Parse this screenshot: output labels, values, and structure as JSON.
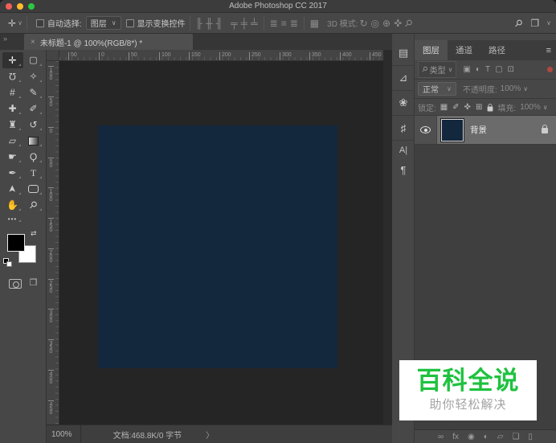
{
  "window": {
    "title": "Adobe Photoshop CC 2017"
  },
  "options_bar": {
    "auto_select_label": "自动选择:",
    "auto_select_value": "图层",
    "show_transform_label": "显示变换控件",
    "mode_3d_label": "3D 模式:"
  },
  "document_tab": {
    "close": "×",
    "title": "未标题-1 @ 100%(RGB/8*) *"
  },
  "toolbar": {
    "collapse_chevron": "»",
    "more_dots": "•••",
    "tools": [
      {
        "name": "move",
        "glyph": "✛"
      },
      {
        "name": "rectangular-marquee",
        "glyph": "▢"
      },
      {
        "name": "lasso",
        "glyph": "Ω"
      },
      {
        "name": "quick-selection",
        "glyph": "✧"
      },
      {
        "name": "crop",
        "glyph": "#"
      },
      {
        "name": "eyedropper",
        "glyph": "✎"
      },
      {
        "name": "spot-healing",
        "glyph": "✚"
      },
      {
        "name": "brush",
        "glyph": "✐"
      },
      {
        "name": "clone-stamp",
        "glyph": "♜"
      },
      {
        "name": "history-brush",
        "glyph": "↺"
      },
      {
        "name": "eraser",
        "glyph": "▱"
      },
      {
        "name": "smudge",
        "glyph": "☛"
      },
      {
        "name": "dodge",
        "glyph": "Ϙ"
      },
      {
        "name": "pen",
        "glyph": "✒"
      },
      {
        "name": "type",
        "glyph": "T"
      },
      {
        "name": "path-selection",
        "glyph": "➤"
      },
      {
        "name": "hand",
        "glyph": "✋"
      },
      {
        "name": "zoom",
        "glyph": "⚲"
      }
    ]
  },
  "icons": {
    "move_option": "✛",
    "chevron_down": "∨",
    "align": [
      "╟",
      "╫",
      "╢",
      "╤",
      "╪",
      "╧"
    ],
    "distribute": [
      "≣",
      "≡",
      "≣"
    ],
    "auto_align": "▦",
    "mode3d": [
      "↻",
      "◎",
      "⊕",
      "✜",
      "⚲"
    ],
    "magnifier": "⚲",
    "workspace": "❐",
    "search": "⚲",
    "panel_menu": "≡",
    "filter_icons": [
      "▣",
      "◐",
      "T",
      "▢",
      "⊡"
    ],
    "lock_icons": [
      "▦",
      "✐",
      "✜",
      "⊞"
    ],
    "bottom_icons": [
      "∞",
      "fx",
      "◉",
      "◐",
      "▱",
      "❏",
      "▯"
    ],
    "screen_mode": "❐"
  },
  "panel_strip": [
    {
      "name": "color-panel",
      "glyph": "▤"
    },
    {
      "name": "adjustments-panel",
      "glyph": "⊿"
    },
    {
      "name": "shapes-panel",
      "glyph": "❀"
    },
    {
      "name": "properties-panel",
      "glyph": "♯"
    },
    {
      "name": "character-panel",
      "glyph": "A|"
    },
    {
      "name": "paragraph-panel",
      "glyph": "¶"
    }
  ],
  "rulers": {
    "top": [
      "50",
      "0",
      "50",
      "100",
      "150",
      "200",
      "250",
      "300",
      "350",
      "400",
      "450"
    ],
    "left": [
      "100",
      "50",
      "0",
      "50",
      "100",
      "150",
      "200",
      "250",
      "300",
      "350",
      "400",
      "450"
    ]
  },
  "canvas": {
    "fill": "#13273d"
  },
  "layers_panel": {
    "tabs": [
      {
        "label": "图层"
      },
      {
        "label": "通道"
      },
      {
        "label": "路径"
      }
    ],
    "filter": {
      "kind": "类型"
    },
    "blend": {
      "value": "正常",
      "opacity_label": "不透明度:",
      "opacity_value": "100%"
    },
    "lock": {
      "label": "锁定:",
      "fill_label": "填充:",
      "fill_value": "100%"
    },
    "layers": [
      {
        "name": "背景",
        "locked": true
      }
    ]
  },
  "status_bar": {
    "zoom": "100%",
    "doc": "文档:468.8K/0 字节",
    "chevron": "〉"
  },
  "watermark": {
    "title": "百科全说",
    "subtitle": "助你轻松解决"
  },
  "colors": {
    "canvas_fill": "#13273d",
    "watermark_green": "#1fc23f",
    "layer_selected": "#6b6b6b"
  }
}
